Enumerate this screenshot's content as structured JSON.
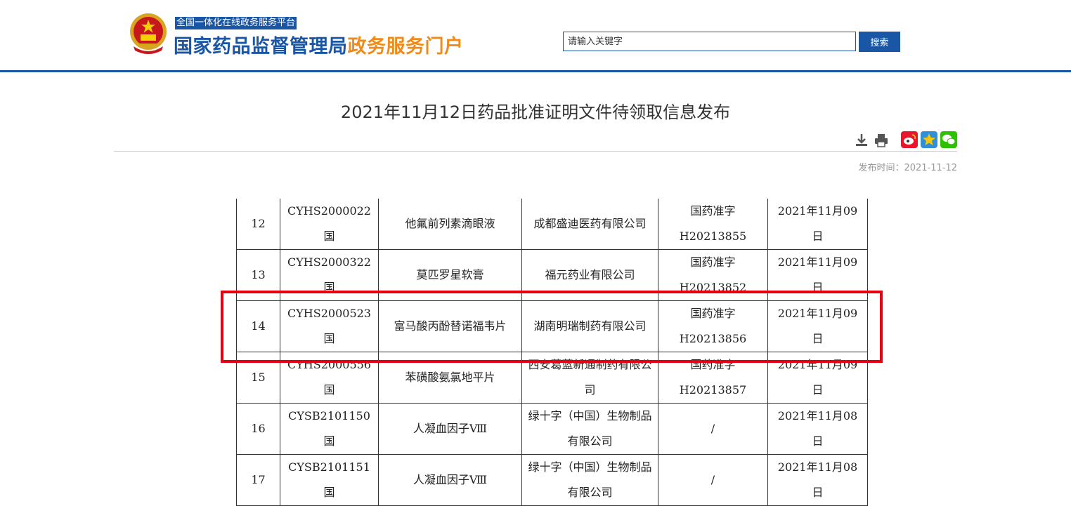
{
  "header": {
    "sub_title": "全国一体化在线政务服务平台",
    "main_title_blue": "国家药品监督管理局",
    "main_title_orange": "政务服务门户",
    "search_placeholder": "请输入关键字",
    "search_button": "搜索"
  },
  "article": {
    "title": "2021年11月12日药品批准证明文件待领取信息发布",
    "publish_time": "发布时间：2021-11-12"
  },
  "toolbar_icons": [
    "download-icon",
    "print-icon",
    "weibo-icon",
    "qzone-icon",
    "wechat-icon"
  ],
  "table": {
    "rows": [
      {
        "no": "12",
        "accept_no": "CYHS2000022国",
        "drug": "他氟前列素滴眼液",
        "company": "成都盛迪医药有限公司",
        "approval": "国药准字H20213855",
        "date": "2021年11月09日"
      },
      {
        "no": "13",
        "accept_no": "CYHS2000322国",
        "drug": "莫匹罗星软膏",
        "company": "福元药业有限公司",
        "approval": "国药准字H20213852",
        "date": "2021年11月09日"
      },
      {
        "no": "14",
        "accept_no": "CYHS2000523国",
        "drug": "富马酸丙酚替诺福韦片",
        "company": "湖南明瑞制药有限公司",
        "approval": "国药准字H20213856",
        "date": "2021年11月09日"
      },
      {
        "no": "15",
        "accept_no": "CYHS2000556国",
        "drug": "苯磺酸氨氯地平片",
        "company": "西安葛蓝新通制药有限公司",
        "approval": "国药准字H20213857",
        "date": "2021年11月09日"
      },
      {
        "no": "16",
        "accept_no": "CYSB2101150国",
        "drug": "人凝血因子Ⅷ",
        "company": "绿十字（中国）生物制品有限公司",
        "approval": "/",
        "date": "2021年11月08日"
      },
      {
        "no": "17",
        "accept_no": "CYSB2101151国",
        "drug": "人凝血因子Ⅷ",
        "company": "绿十字（中国）生物制品有限公司",
        "approval": "/",
        "date": "2021年11月08日"
      }
    ]
  },
  "colors": {
    "brand_blue": "#1a56a6",
    "brand_orange": "#ef8a1b",
    "highlight_red": "#e60012"
  }
}
